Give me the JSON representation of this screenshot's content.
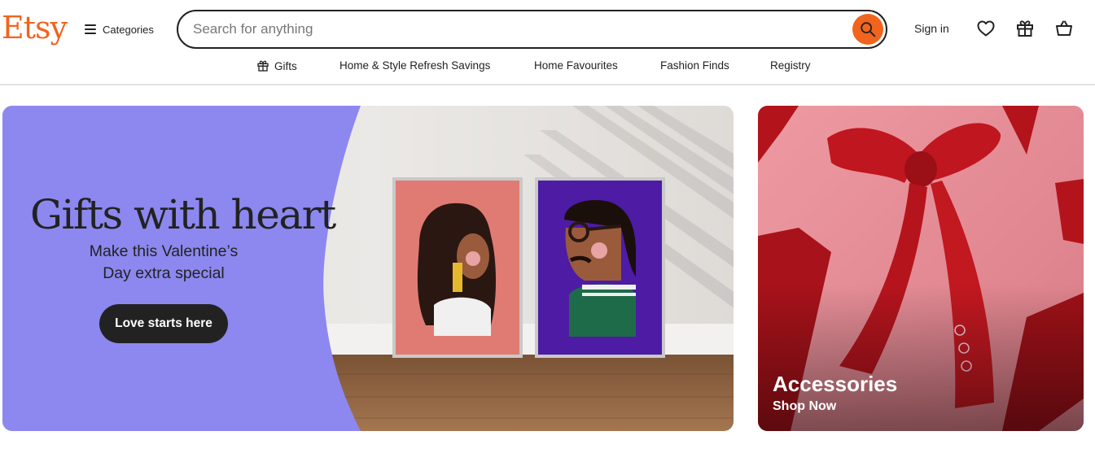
{
  "brand": {
    "logo": "Etsy",
    "accent": "#F1641E"
  },
  "header": {
    "categories_label": "Categories",
    "search": {
      "placeholder": "Search for anything",
      "value": ""
    },
    "signin_label": "Sign in",
    "icons": [
      "menu-icon",
      "search-icon",
      "heart-icon",
      "gift-icon",
      "basket-icon"
    ]
  },
  "subnav": {
    "items": [
      {
        "label": "Gifts",
        "icon": "gift-icon"
      },
      {
        "label": "Home & Style Refresh Savings"
      },
      {
        "label": "Home Favourites"
      },
      {
        "label": "Fashion Finds"
      },
      {
        "label": "Registry"
      }
    ]
  },
  "hero": {
    "title": "Gifts with heart",
    "subtitle_line1": "Make this Valentine’s",
    "subtitle_line2": "Day extra special",
    "cta_label": "Love starts here",
    "panel_color": "#8C88EF"
  },
  "card": {
    "title": "Accessories",
    "link_label": "Shop Now",
    "bg_color": "#E39098"
  }
}
